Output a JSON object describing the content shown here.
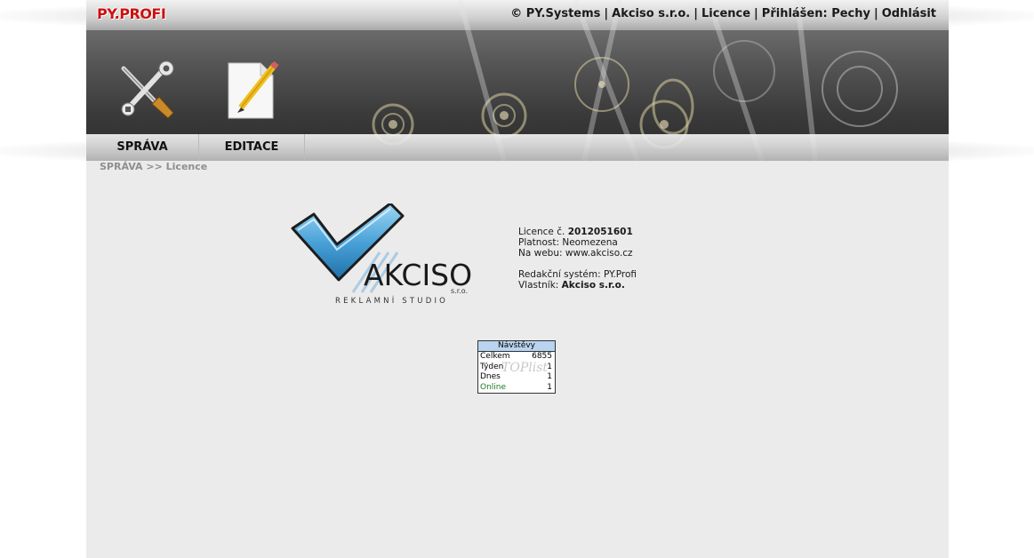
{
  "header": {
    "brand": "PY.PROFI",
    "links": {
      "copyright": "© PY.Systems",
      "company": "Akciso s.r.o.",
      "licence": "Licence",
      "logged_in": "Přihlášen: Pechy",
      "logout": "Odhlásit",
      "separator": "|"
    },
    "nav": [
      {
        "label": "SPRÁVA",
        "icon": "tools-icon"
      },
      {
        "label": "EDITACE",
        "icon": "edit-document-icon"
      }
    ]
  },
  "breadcrumb": {
    "root": "SPRÁVA",
    "separator": ">>",
    "current": "Licence"
  },
  "logo": {
    "name": "AKCISO",
    "suffix": "s.r.o.",
    "tagline": "REKLAMNÍ STUDIO"
  },
  "licence": {
    "number_label": "Licence č.",
    "number": "2012051601",
    "validity_label": "Platnost:",
    "validity": "Neomezena",
    "web_label": "Na webu:",
    "web": "www.akciso.cz",
    "system_label": "Redakční systém:",
    "system": "PY.Profi",
    "owner_label": "Vlastník:",
    "owner": "Akciso s.r.o."
  },
  "counter": {
    "title": "Návštěvy",
    "watermark": "TOPlist",
    "rows": [
      {
        "label": "Celkem",
        "value": "6855"
      },
      {
        "label": "Týden",
        "value": "1"
      },
      {
        "label": "Dnes",
        "value": "1"
      },
      {
        "label": "Online",
        "value": "1"
      }
    ]
  },
  "colors": {
    "brand": "#cc1010",
    "content_bg": "#ebebeb",
    "counter_header": "#b8d4f0",
    "online": "#1d7a1d",
    "logo_check": "#4aa3d8"
  }
}
